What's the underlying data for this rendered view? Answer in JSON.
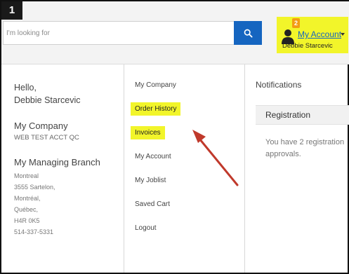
{
  "step": {
    "number": "1"
  },
  "search": {
    "placeholder": "I'm looking for"
  },
  "account": {
    "link_label": "My Account",
    "user_name": "Debbie Starcevic",
    "notification_count": "2"
  },
  "greeting": {
    "hello": "Hello,",
    "name": "Debbie Starcevic"
  },
  "company": {
    "title": "My Company",
    "name": "WEB TEST ACCT QC"
  },
  "branch": {
    "title": "My Managing Branch",
    "lines": [
      "Montreal",
      "3555 Sartelon,",
      "Montréal,",
      "Québec,",
      "H4R 0K5",
      "514-337-5331"
    ]
  },
  "menu": {
    "items": [
      {
        "label": "My Company",
        "highlighted": false
      },
      {
        "label": "Order History",
        "highlighted": true
      },
      {
        "label": "Invoices",
        "highlighted": true
      },
      {
        "label": "My Account",
        "highlighted": false
      },
      {
        "label": "My Joblist",
        "highlighted": false
      },
      {
        "label": "Saved Cart",
        "highlighted": false
      },
      {
        "label": "Logout",
        "highlighted": false
      }
    ]
  },
  "notifications": {
    "title": "Notifications",
    "registration_header": "Registration",
    "registration_text": "You have  2 registration approvals."
  },
  "colors": {
    "highlight": "#f2f52a",
    "search_button": "#1565c0",
    "arrow": "#c0392b",
    "badge": "#f39c12"
  },
  "icons": {
    "search": "search-icon",
    "user": "user-icon",
    "caret": "chevron-down-icon",
    "annotation": "arrow-annotation"
  }
}
